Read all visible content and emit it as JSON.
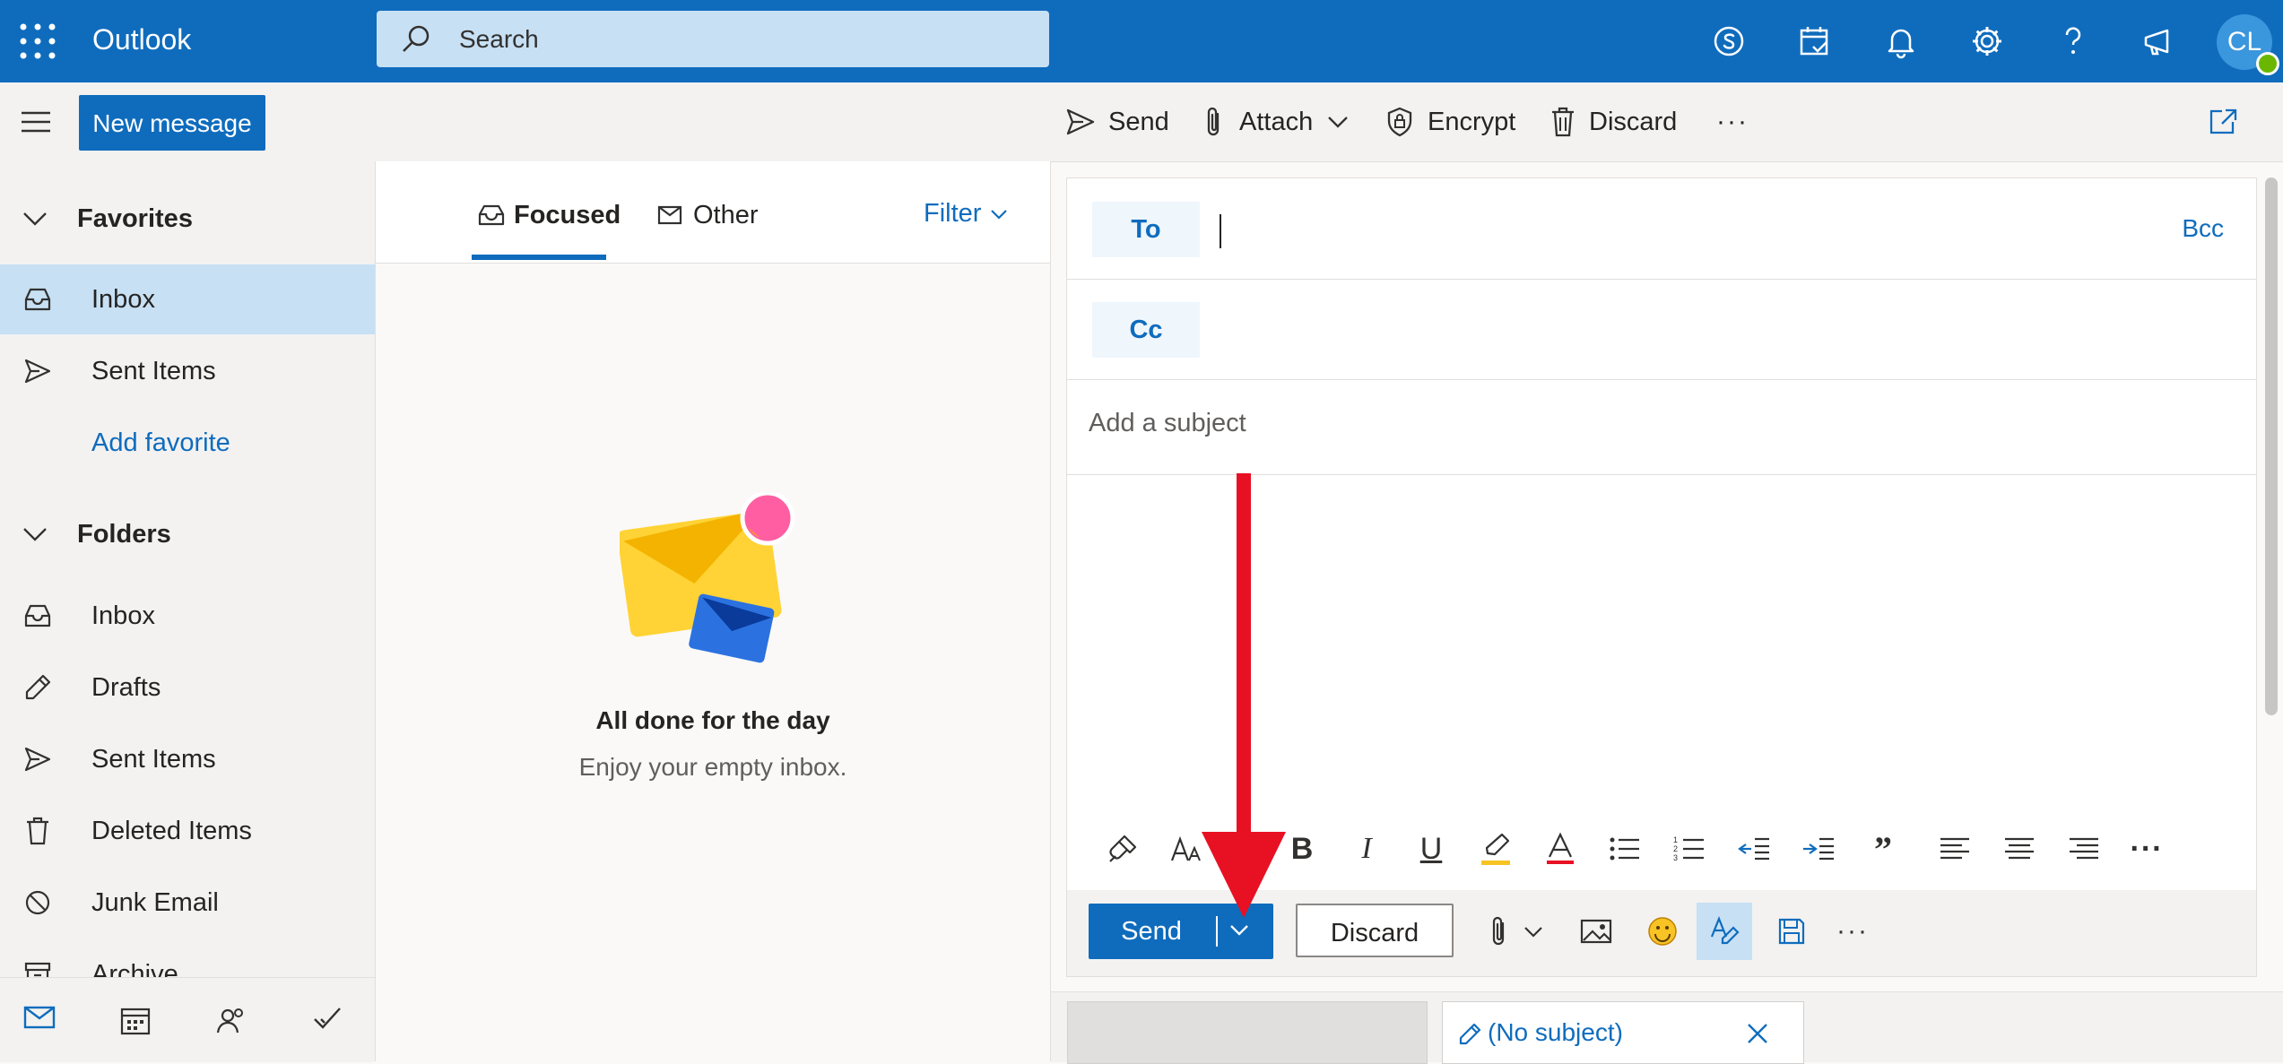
{
  "app": {
    "name": "Outlook"
  },
  "search": {
    "placeholder": "Search"
  },
  "user": {
    "initials": "CL"
  },
  "command_bar": {
    "new_message": "New message",
    "send": "Send",
    "attach": "Attach",
    "encrypt": "Encrypt",
    "discard": "Discard",
    "more": "···"
  },
  "nav": {
    "favorites_header": "Favorites",
    "favorites": [
      {
        "label": "Inbox",
        "icon": "inbox-icon",
        "selected": true
      },
      {
        "label": "Sent Items",
        "icon": "send-icon"
      }
    ],
    "add_favorite": "Add favorite",
    "folders_header": "Folders",
    "folders": [
      {
        "label": "Inbox",
        "icon": "inbox-icon"
      },
      {
        "label": "Drafts",
        "icon": "pencil-icon"
      },
      {
        "label": "Sent Items",
        "icon": "send-icon"
      },
      {
        "label": "Deleted Items",
        "icon": "trash-icon"
      },
      {
        "label": "Junk Email",
        "icon": "block-icon"
      },
      {
        "label": "Archive",
        "icon": "archive-icon"
      }
    ],
    "bottom_icons": [
      "mail-icon",
      "calendar-icon",
      "people-icon",
      "todo-icon"
    ]
  },
  "message_list": {
    "tabs": [
      {
        "label": "Focused",
        "active": true
      },
      {
        "label": "Other"
      }
    ],
    "filter": "Filter",
    "empty_title": "All done for the day",
    "empty_subtitle": "Enjoy your empty inbox."
  },
  "compose": {
    "to_label": "To",
    "cc_label": "Cc",
    "bcc_label": "Bcc",
    "subject_placeholder": "Add a subject",
    "send": "Send",
    "discard": "Discard",
    "more": "···"
  },
  "drafts": {
    "tab_title": "(No subject)"
  },
  "colors": {
    "brand": "#0f6cbd",
    "selection": "#c7e0f4",
    "annotation": "#e81123"
  }
}
